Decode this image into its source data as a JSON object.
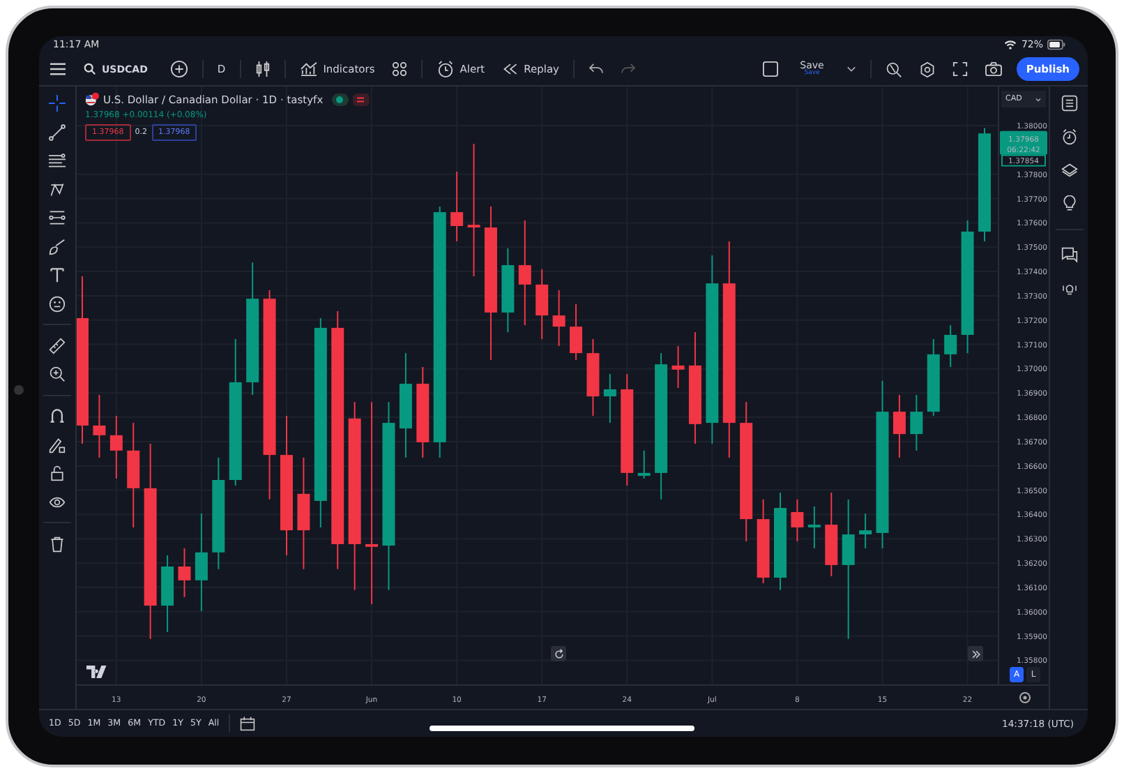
{
  "status_bar": {
    "time": "11:17 AM",
    "battery": "72%"
  },
  "toolbar": {
    "symbol": "USDCAD",
    "interval": "D",
    "indicators": "Indicators",
    "alert": "Alert",
    "replay": "Replay",
    "save": "Save",
    "save_status": "Save",
    "publish": "Publish"
  },
  "legend": {
    "title": "U.S. Dollar / Canadian Dollar · 1D · tastyfx",
    "change": "1.37968 +0.00114 (+0.08%)",
    "sell": "1.37968",
    "spread": "0.2",
    "buy": "1.37968"
  },
  "currency": "CAD",
  "chart": {
    "chart_data": {
      "type": "candlestick",
      "categories": [
        null,
        null,
        "13",
        null,
        null,
        null,
        null,
        "20",
        null,
        null,
        null,
        null,
        "27",
        null,
        null,
        null,
        null,
        "Jun",
        null,
        null,
        null,
        null,
        "10",
        null,
        null,
        null,
        null,
        "17",
        null,
        null,
        null,
        null,
        "24",
        null,
        null,
        null,
        null,
        "Jul",
        null,
        null,
        null,
        null,
        "8",
        null,
        null,
        null,
        null,
        "15",
        null,
        null,
        null,
        null,
        "22",
        null
      ],
      "ohlc": [
        [
          1.37208,
          1.3738,
          1.36691,
          1.36766
        ],
        [
          1.36766,
          1.36892,
          1.36634,
          1.36726
        ],
        [
          1.36726,
          1.36806,
          1.36548,
          1.36663
        ],
        [
          1.36663,
          1.36777,
          1.36347,
          1.36508
        ],
        [
          1.36508,
          1.36691,
          1.35888,
          1.36025
        ],
        [
          1.36025,
          1.36232,
          1.35916,
          1.36186
        ],
        [
          1.36186,
          1.36261,
          1.3606,
          1.36129
        ],
        [
          1.36129,
          1.36404,
          1.36002,
          1.36244
        ],
        [
          1.36244,
          1.36634,
          1.36175,
          1.36542
        ],
        [
          1.36542,
          1.37122,
          1.36519,
          1.36944
        ],
        [
          1.36944,
          1.37437,
          1.36892,
          1.37288
        ],
        [
          1.37288,
          1.37323,
          1.36462,
          1.36645
        ],
        [
          1.36645,
          1.36806,
          1.36232,
          1.36335
        ],
        [
          1.36485,
          1.36634,
          1.36175,
          1.36335
        ],
        [
          1.36456,
          1.37208,
          1.36347,
          1.37168
        ],
        [
          1.37168,
          1.37237,
          1.36175,
          1.36278
        ],
        [
          1.36795,
          1.36863,
          1.36089,
          1.36278
        ],
        [
          1.36278,
          1.36863,
          1.36031,
          1.36267
        ],
        [
          1.36272,
          1.36863,
          1.36089,
          1.36777
        ],
        [
          1.36754,
          1.37064,
          1.36634,
          1.36938
        ],
        [
          1.36938,
          1.37007,
          1.36634,
          1.36697
        ],
        [
          1.36697,
          1.37667,
          1.36634,
          1.37644
        ],
        [
          1.37644,
          1.37811,
          1.37524,
          1.37587
        ],
        [
          1.37592,
          1.37925,
          1.3738,
          1.37581
        ],
        [
          1.37581,
          1.37667,
          1.37036,
          1.37231
        ],
        [
          1.37231,
          1.37495,
          1.3715,
          1.37426
        ],
        [
          1.37426,
          1.3761,
          1.37179,
          1.37346
        ],
        [
          1.37346,
          1.37409,
          1.37122,
          1.37219
        ],
        [
          1.37219,
          1.37323,
          1.37093,
          1.37173
        ],
        [
          1.37173,
          1.37265,
          1.37036,
          1.37064
        ],
        [
          1.37064,
          1.37122,
          1.36806,
          1.36886
        ],
        [
          1.36886,
          1.36978,
          1.36777,
          1.36915
        ],
        [
          1.36915,
          1.36978,
          1.36519,
          1.36571
        ],
        [
          1.36559,
          1.36663,
          1.36548,
          1.36571
        ],
        [
          1.36571,
          1.37064,
          1.36462,
          1.37018
        ],
        [
          1.37013,
          1.37093,
          1.36921,
          1.36996
        ],
        [
          1.37013,
          1.3715,
          1.36691,
          1.36772
        ],
        [
          1.36777,
          1.37466,
          1.36691,
          1.37351
        ],
        [
          1.37351,
          1.37524,
          1.36634,
          1.36777
        ],
        [
          1.36777,
          1.36863,
          1.36289,
          1.36381
        ],
        [
          1.36381,
          1.36462,
          1.36117,
          1.3614
        ],
        [
          1.3614,
          1.3649,
          1.36089,
          1.36427
        ],
        [
          1.3641,
          1.36462,
          1.36289,
          1.36347
        ],
        [
          1.36347,
          1.36433,
          1.36261,
          1.36358
        ],
        [
          1.36358,
          1.3649,
          1.36146,
          1.36192
        ],
        [
          1.36192,
          1.36462,
          1.35888,
          1.36318
        ],
        [
          1.36318,
          1.36404,
          1.36261,
          1.36335
        ],
        [
          1.36324,
          1.3695,
          1.36261,
          1.36823
        ],
        [
          1.36823,
          1.36892,
          1.36634,
          1.36731
        ],
        [
          1.36731,
          1.36892,
          1.36663,
          1.36823
        ],
        [
          1.36823,
          1.37122,
          1.36806,
          1.37059
        ],
        [
          1.37059,
          1.37179,
          1.37007,
          1.37139
        ],
        [
          1.37139,
          1.3761,
          1.37064,
          1.37564
        ],
        [
          1.37564,
          1.3799,
          1.37524,
          1.37968
        ]
      ],
      "ylim": [
        1.35698,
        1.38161
      ],
      "grid": true,
      "yticks": [
        {
          "value": 1.38,
          "label": "1.38000"
        },
        {
          "value": 1.378,
          "label": "1.37800"
        },
        {
          "value": 1.377,
          "label": "1.37700"
        },
        {
          "value": 1.376,
          "label": "1.37600"
        },
        {
          "value": 1.375,
          "label": "1.37500"
        },
        {
          "value": 1.374,
          "label": "1.37400"
        },
        {
          "value": 1.373,
          "label": "1.37300"
        },
        {
          "value": 1.372,
          "label": "1.37200"
        },
        {
          "value": 1.371,
          "label": "1.37100"
        },
        {
          "value": 1.37,
          "label": "1.37000"
        },
        {
          "value": 1.369,
          "label": "1.36900"
        },
        {
          "value": 1.368,
          "label": "1.36800"
        },
        {
          "value": 1.367,
          "label": "1.36700"
        },
        {
          "value": 1.366,
          "label": "1.36600"
        },
        {
          "value": 1.365,
          "label": "1.36500"
        },
        {
          "value": 1.364,
          "label": "1.36400"
        },
        {
          "value": 1.363,
          "label": "1.36300"
        },
        {
          "value": 1.362,
          "label": "1.36200"
        },
        {
          "value": 1.361,
          "label": "1.36100"
        },
        {
          "value": 1.36,
          "label": "1.36000"
        },
        {
          "value": 1.359,
          "label": "1.35900"
        },
        {
          "value": 1.358,
          "label": "1.35800"
        }
      ]
    }
  },
  "last_price": "1.37968",
  "countdown": "06:22:42",
  "prev_close": "1.37854",
  "scale_modes": [
    {
      "label": "A",
      "selected": true
    },
    {
      "label": "L",
      "selected": false
    }
  ],
  "ranges": [
    "1D",
    "5D",
    "1M",
    "3M",
    "6M",
    "YTD",
    "1Y",
    "5Y",
    "All"
  ],
  "clock": "14:37:18 (UTC)"
}
